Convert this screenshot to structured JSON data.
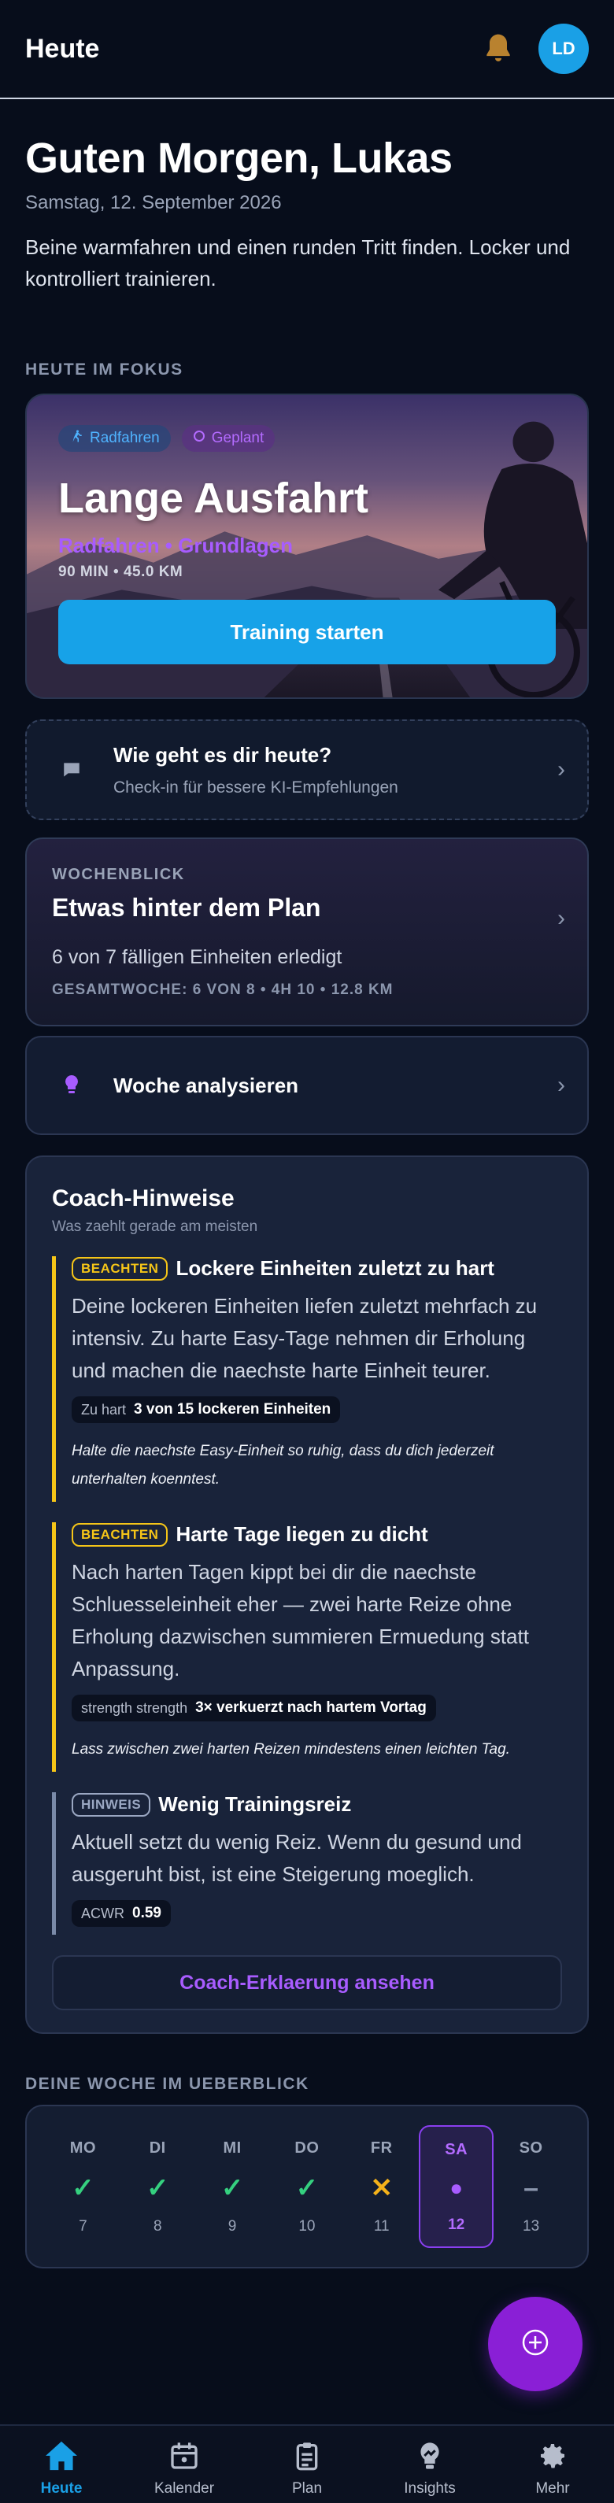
{
  "header": {
    "title": "Heute",
    "avatar_initials": "LD",
    "notification_icon": "bell-icon"
  },
  "greeting": {
    "title": "Guten Morgen, Lukas",
    "date": "Samstag, 12. September 2026",
    "intro": "Beine warmfahren und einen runden Tritt finden. Locker und kontrolliert trainieren."
  },
  "focus": {
    "section_label": "HEUTE IM FOKUS",
    "chip_sport": "Radfahren",
    "chip_status": "Geplant",
    "title": "Lange Ausfahrt",
    "subtitle": "Radfahren • Grundlagen",
    "meta": "90 MIN • 45.0 KM",
    "start_label": "Training starten"
  },
  "checkin": {
    "title": "Wie geht es dir heute?",
    "subtitle": "Check-in für bessere KI-Empfehlungen"
  },
  "week_card": {
    "kicker": "WOCHENBLICK",
    "title": "Etwas hinter dem Plan",
    "progress_text": "6 von 7 fälligen Einheiten erledigt",
    "total": "GESAMTWOCHE: 6 VON 8 • 4H 10 • 12.8 KM"
  },
  "analyze": {
    "label": "Woche analysieren"
  },
  "coach": {
    "title": "Coach-Hinweise",
    "subtitle": "Was zaehlt gerade am meisten",
    "hints": [
      {
        "badge": "BEACHTEN",
        "title": "Lockere Einheiten zuletzt zu hart",
        "body": "Deine lockeren Einheiten liefen zuletzt mehrfach zu intensiv. Zu harte Easy-Tage nehmen dir Erholung und machen die naechste harte Einheit teurer.",
        "stat_key": "Zu hart",
        "stat_value": "3 von 15 lockeren Einheiten",
        "tip": "Halte die naechste Easy-Einheit so ruhig, dass du dich jederzeit unterhalten koenntest."
      },
      {
        "badge": "BEACHTEN",
        "title": "Harte Tage liegen zu dicht",
        "body": "Nach harten Tagen kippt bei dir die naechste Schluesseleinheit eher — zwei harte Reize ohne Erholung dazwischen summieren Ermuedung statt Anpassung.",
        "stat_key": "strength strength",
        "stat_value": "3× verkuerzt nach hartem Vortag",
        "tip": "Lass zwischen zwei harten Reizen mindestens einen leichten Tag."
      },
      {
        "badge": "HINWEIS",
        "title": "Wenig Trainingsreiz",
        "body": "Aktuell setzt du wenig Reiz. Wenn du gesund und ausgeruht bist, ist eine Steigerung moeglich.",
        "stat_key": "ACWR",
        "stat_value": "0.59"
      }
    ],
    "explain_label": "Coach-Erklaerung ansehen"
  },
  "overview": {
    "section_label": "DEINE WOCHE IM UEBERBLICK",
    "days": [
      {
        "name": "MO",
        "status": "✓",
        "date": "7"
      },
      {
        "name": "DI",
        "status": "✓",
        "date": "8"
      },
      {
        "name": "MI",
        "status": "✓",
        "date": "9"
      },
      {
        "name": "DO",
        "status": "✓",
        "date": "10"
      },
      {
        "name": "FR",
        "status": "✕",
        "date": "11"
      },
      {
        "name": "SA",
        "status": "●",
        "date": "12"
      },
      {
        "name": "SO",
        "status": "–",
        "date": "13"
      }
    ]
  },
  "nav": {
    "items": [
      {
        "label": "Heute"
      },
      {
        "label": "Kalender"
      },
      {
        "label": "Plan"
      },
      {
        "label": "Insights"
      },
      {
        "label": "Mehr"
      }
    ],
    "active": "Heute"
  },
  "colors": {
    "accent": "#1aa0e6",
    "purple": "#a85cff",
    "warning": "#f5c518",
    "success": "#35d07f"
  }
}
